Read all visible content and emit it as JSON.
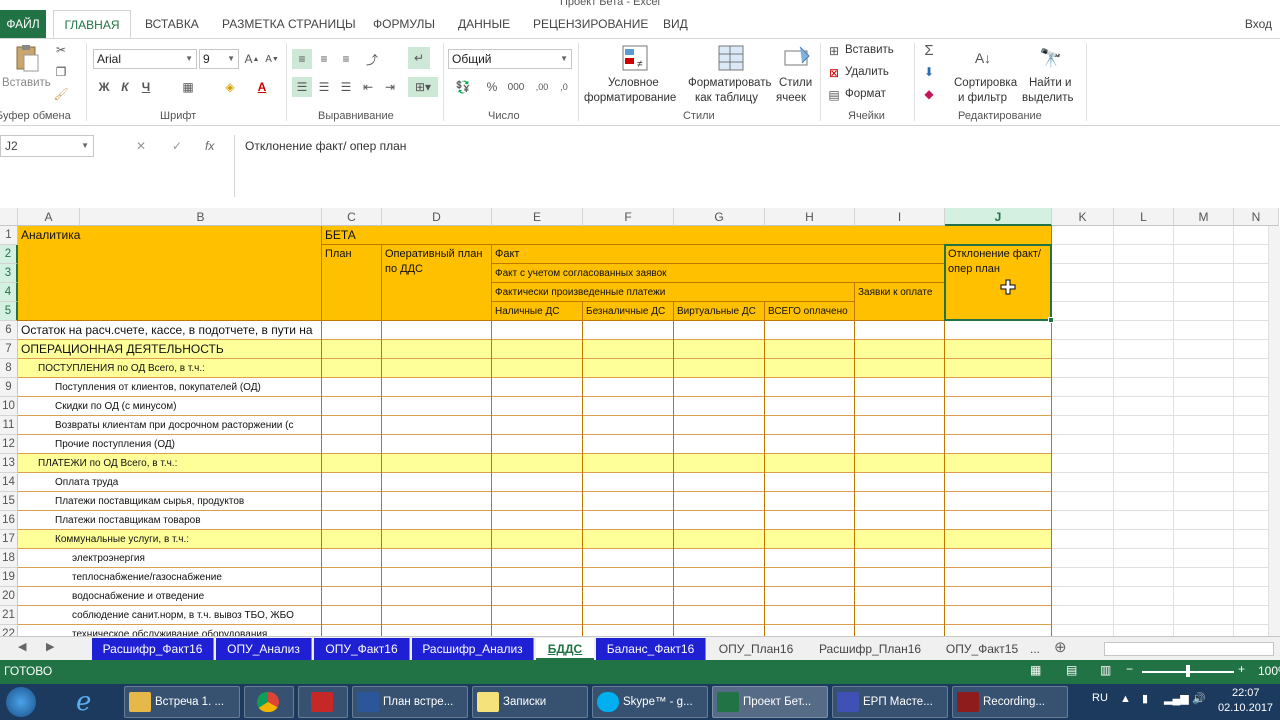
{
  "window": {
    "title": "Проект Бета - Excel"
  },
  "ribbon_tabs": [
    "ФАЙЛ",
    "ГЛАВНАЯ",
    "ВСТАВКА",
    "РАЗМЕТКА СТРАНИЦЫ",
    "ФОРМУЛЫ",
    "ДАННЫЕ",
    "РЕЦЕНЗИРОВАНИЕ",
    "ВИД"
  ],
  "sign_in": "Вход",
  "ribbon": {
    "clipboard": {
      "paste": "Вставить",
      "group": "Буфер обмена"
    },
    "font": {
      "name": "Arial",
      "size": "9",
      "bold": "Ж",
      "italic": "К",
      "underline": "Ч",
      "group": "Шрифт"
    },
    "alignment": {
      "group": "Выравнивание"
    },
    "number": {
      "format": "Общий",
      "group": "Число"
    },
    "styles": {
      "conditional": [
        "Условное",
        "форматирование"
      ],
      "as_table": [
        "Форматировать",
        "как таблицу"
      ],
      "cell_styles": [
        "Стили",
        "ячеек"
      ],
      "group": "Стили"
    },
    "cells": {
      "insert": "Вставить",
      "delete": "Удалить",
      "format": "Формат",
      "group": "Ячейки"
    },
    "editing": {
      "sort": [
        "Сортировка",
        "и фильтр"
      ],
      "find": [
        "Найти и",
        "выделить"
      ],
      "group": "Редактирование"
    }
  },
  "formula_bar": {
    "name_box": "J2",
    "formula": "Отклонение факт/ опер план"
  },
  "columns": [
    "A",
    "B",
    "C",
    "D",
    "E",
    "F",
    "G",
    "H",
    "I",
    "J",
    "K",
    "L",
    "M",
    "N"
  ],
  "rows": [
    "1",
    "2",
    "3",
    "4",
    "5",
    "6",
    "7",
    "8",
    "9",
    "10",
    "11",
    "12",
    "13",
    "14",
    "15",
    "16",
    "17",
    "18",
    "19",
    "20",
    "21",
    "22"
  ],
  "header_cells": {
    "analytics": "Аналитика",
    "beta": "БЕТА",
    "plan": "План",
    "oper_plan": "Оперативный план по ДДС",
    "fact": "Факт",
    "fact_approved": "Факт с учетом согласованных заявок",
    "fact_paid": "Фактически произведенные платежи",
    "requests": "Заявки к оплате",
    "cash": "Наличные ДС",
    "noncash": "Безналичные ДС",
    "virtual": "Виртуальные ДС",
    "total_paid": "ВСЕГО оплачено",
    "deviation": "Отклонение факт/ опер план"
  },
  "data_rows": [
    "Остаток на расч.счете, кассе, в подотчете, в пути на",
    "ОПЕРАЦИОННАЯ ДЕЯТЕЛЬНОСТЬ",
    "ПОСТУПЛЕНИЯ по ОД Всего, в т.ч.:",
    "Поступления от клиентов, покупателей (ОД)",
    "Скидки по ОД (с минусом)",
    "Возвраты клиентам при досрочном расторжении (с",
    "Прочие поступления (ОД)",
    "ПЛАТЕЖИ по ОД Всего, в т.ч.:",
    "Оплата труда",
    "Платежи поставщикам сырья, продуктов",
    "Платежи поставщикам товаров",
    "Коммунальные услуги, в т.ч.:",
    "электроэнергия",
    "теплоснабжение/газоснабжение",
    "водоснабжение и отведение",
    "соблюдение санит.норм, в т.ч. вывоз ТБО, ЖБО",
    "техническое обслуживание оборудования"
  ],
  "sheet_tabs": [
    "Расшифр_Факт16",
    "ОПУ_Анализ",
    "ОПУ_Факт16",
    "Расшифр_Анализ",
    "БДДС",
    "Баланс_Факт16",
    "ОПУ_План16",
    "Расшифр_План16",
    "ОПУ_Факт15",
    "..."
  ],
  "status": {
    "ready": "ГОТОВО",
    "zoom": "100%"
  },
  "taskbar": {
    "items": [
      "Встреча 1. ...",
      "",
      "",
      "План встре...",
      "Записки",
      "Skype™ - g...",
      "Проект Бет...",
      "ЕРП Масте...",
      "Recording..."
    ],
    "lang": "RU",
    "time": "22:07",
    "date": "02.10.2017"
  },
  "colors": {
    "accent": "#217346",
    "header_fill": "#ffc000",
    "row_fill": "#ffff99",
    "tab_blue": "#1f1fd4"
  }
}
